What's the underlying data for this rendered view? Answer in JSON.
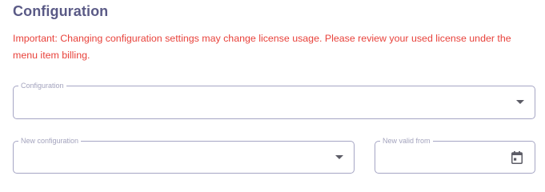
{
  "page": {
    "title": "Configuration",
    "warning": "Important: Changing configuration settings may change license usage. Please review your used license under the menu item billing."
  },
  "fields": {
    "configuration": {
      "label": "Configuration",
      "value": "",
      "icon": "chevron-down-icon"
    },
    "new_configuration": {
      "label": "New configuration",
      "value": "",
      "icon": "chevron-down-icon"
    },
    "new_valid_from": {
      "label": "New valid from",
      "value": "",
      "icon": "calendar-icon"
    }
  },
  "colors": {
    "title": "#5a5a86",
    "warning": "#e8423b",
    "field_border": "#a6a6c4",
    "field_label": "#a3a3bd",
    "icon": "#5c5c66"
  }
}
